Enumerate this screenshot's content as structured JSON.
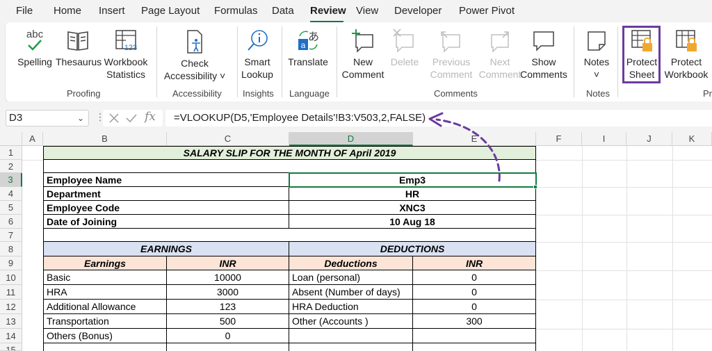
{
  "menu": {
    "items": [
      "File",
      "Home",
      "Insert",
      "Page Layout",
      "Formulas",
      "Data",
      "Review",
      "View",
      "Developer",
      "Power Pivot"
    ],
    "active": "Review"
  },
  "ribbon": {
    "proofing": {
      "spelling": "Spelling",
      "thesaurus": "Thesaurus",
      "workbook_stats_1": "Workbook",
      "workbook_stats_2": "Statistics",
      "spelling_icon_text": "abc",
      "stats_icon_text": "123",
      "label": "Proofing"
    },
    "accessibility": {
      "check_1": "Check",
      "check_2": "Accessibility ˅",
      "label": "Accessibility"
    },
    "insights": {
      "smart_1": "Smart",
      "smart_2": "Lookup",
      "label": "Insights"
    },
    "language": {
      "translate": "Translate",
      "label": "Language"
    },
    "comments": {
      "new_1": "New",
      "new_2": "Comment",
      "delete": "Delete",
      "previous_1": "Previous",
      "previous_2": "Comment",
      "next_1": "Next",
      "next_2": "Comment",
      "show_1": "Show",
      "show_2": "Comments",
      "label": "Comments"
    },
    "notes": {
      "notes_1": "Notes",
      "notes_2": "˅",
      "label": "Notes"
    },
    "protect": {
      "sheet_1": "Protect",
      "sheet_2": "Sheet",
      "workbook_1": "Protect",
      "workbook_2": "Workbook",
      "label_partial": "Pr"
    }
  },
  "formula_bar": {
    "name_box": "D3",
    "fx": "fx",
    "formula": "=VLOOKUP(D5,'Employee Details'!B3:V503,2,FALSE)"
  },
  "columns": [
    "A",
    "B",
    "C",
    "D",
    "E",
    "F",
    "I",
    "J",
    "K"
  ],
  "rows": [
    "1",
    "2",
    "3",
    "4",
    "5",
    "6",
    "7",
    "8",
    "9",
    "10",
    "11",
    "12",
    "13",
    "14",
    "15"
  ],
  "sheet": {
    "title": "SALARY SLIP FOR THE MONTH OF April 2019",
    "employee": [
      {
        "label": "Employee Name",
        "value": "Emp3"
      },
      {
        "label": "Department",
        "value": "HR"
      },
      {
        "label": "Employee Code",
        "value": "XNC3"
      },
      {
        "label": "Date of Joining",
        "value": "10 Aug 18"
      }
    ],
    "earnings_header": "EARNINGS",
    "deductions_header": "DEDUCTIONS",
    "earnings_col": "Earnings",
    "inr_col": "INR",
    "deductions_col": "Deductions",
    "inr_col2": "INR",
    "earnings": [
      {
        "name": "Basic",
        "value": "10000"
      },
      {
        "name": "HRA",
        "value": "3000"
      },
      {
        "name": "Additional Allowance",
        "value": "123"
      },
      {
        "name": "Transportation",
        "value": "500"
      },
      {
        "name": "Others (Bonus)",
        "value": "0"
      }
    ],
    "deductions": [
      {
        "name": "Loan (personal)",
        "value": "0"
      },
      {
        "name": "Absent (Number of days)",
        "value": "0"
      },
      {
        "name": "HRA Deduction",
        "value": "0"
      },
      {
        "name": "Other (Accounts )",
        "value": "300"
      },
      {
        "name": "",
        "value": ""
      }
    ]
  },
  "colors": {
    "accent": "#107c41",
    "highlight": "#6a3b9f",
    "green_fill": "#e2efda",
    "blue_fill": "#d9e1f2",
    "peach_fill": "#fce4d6"
  }
}
